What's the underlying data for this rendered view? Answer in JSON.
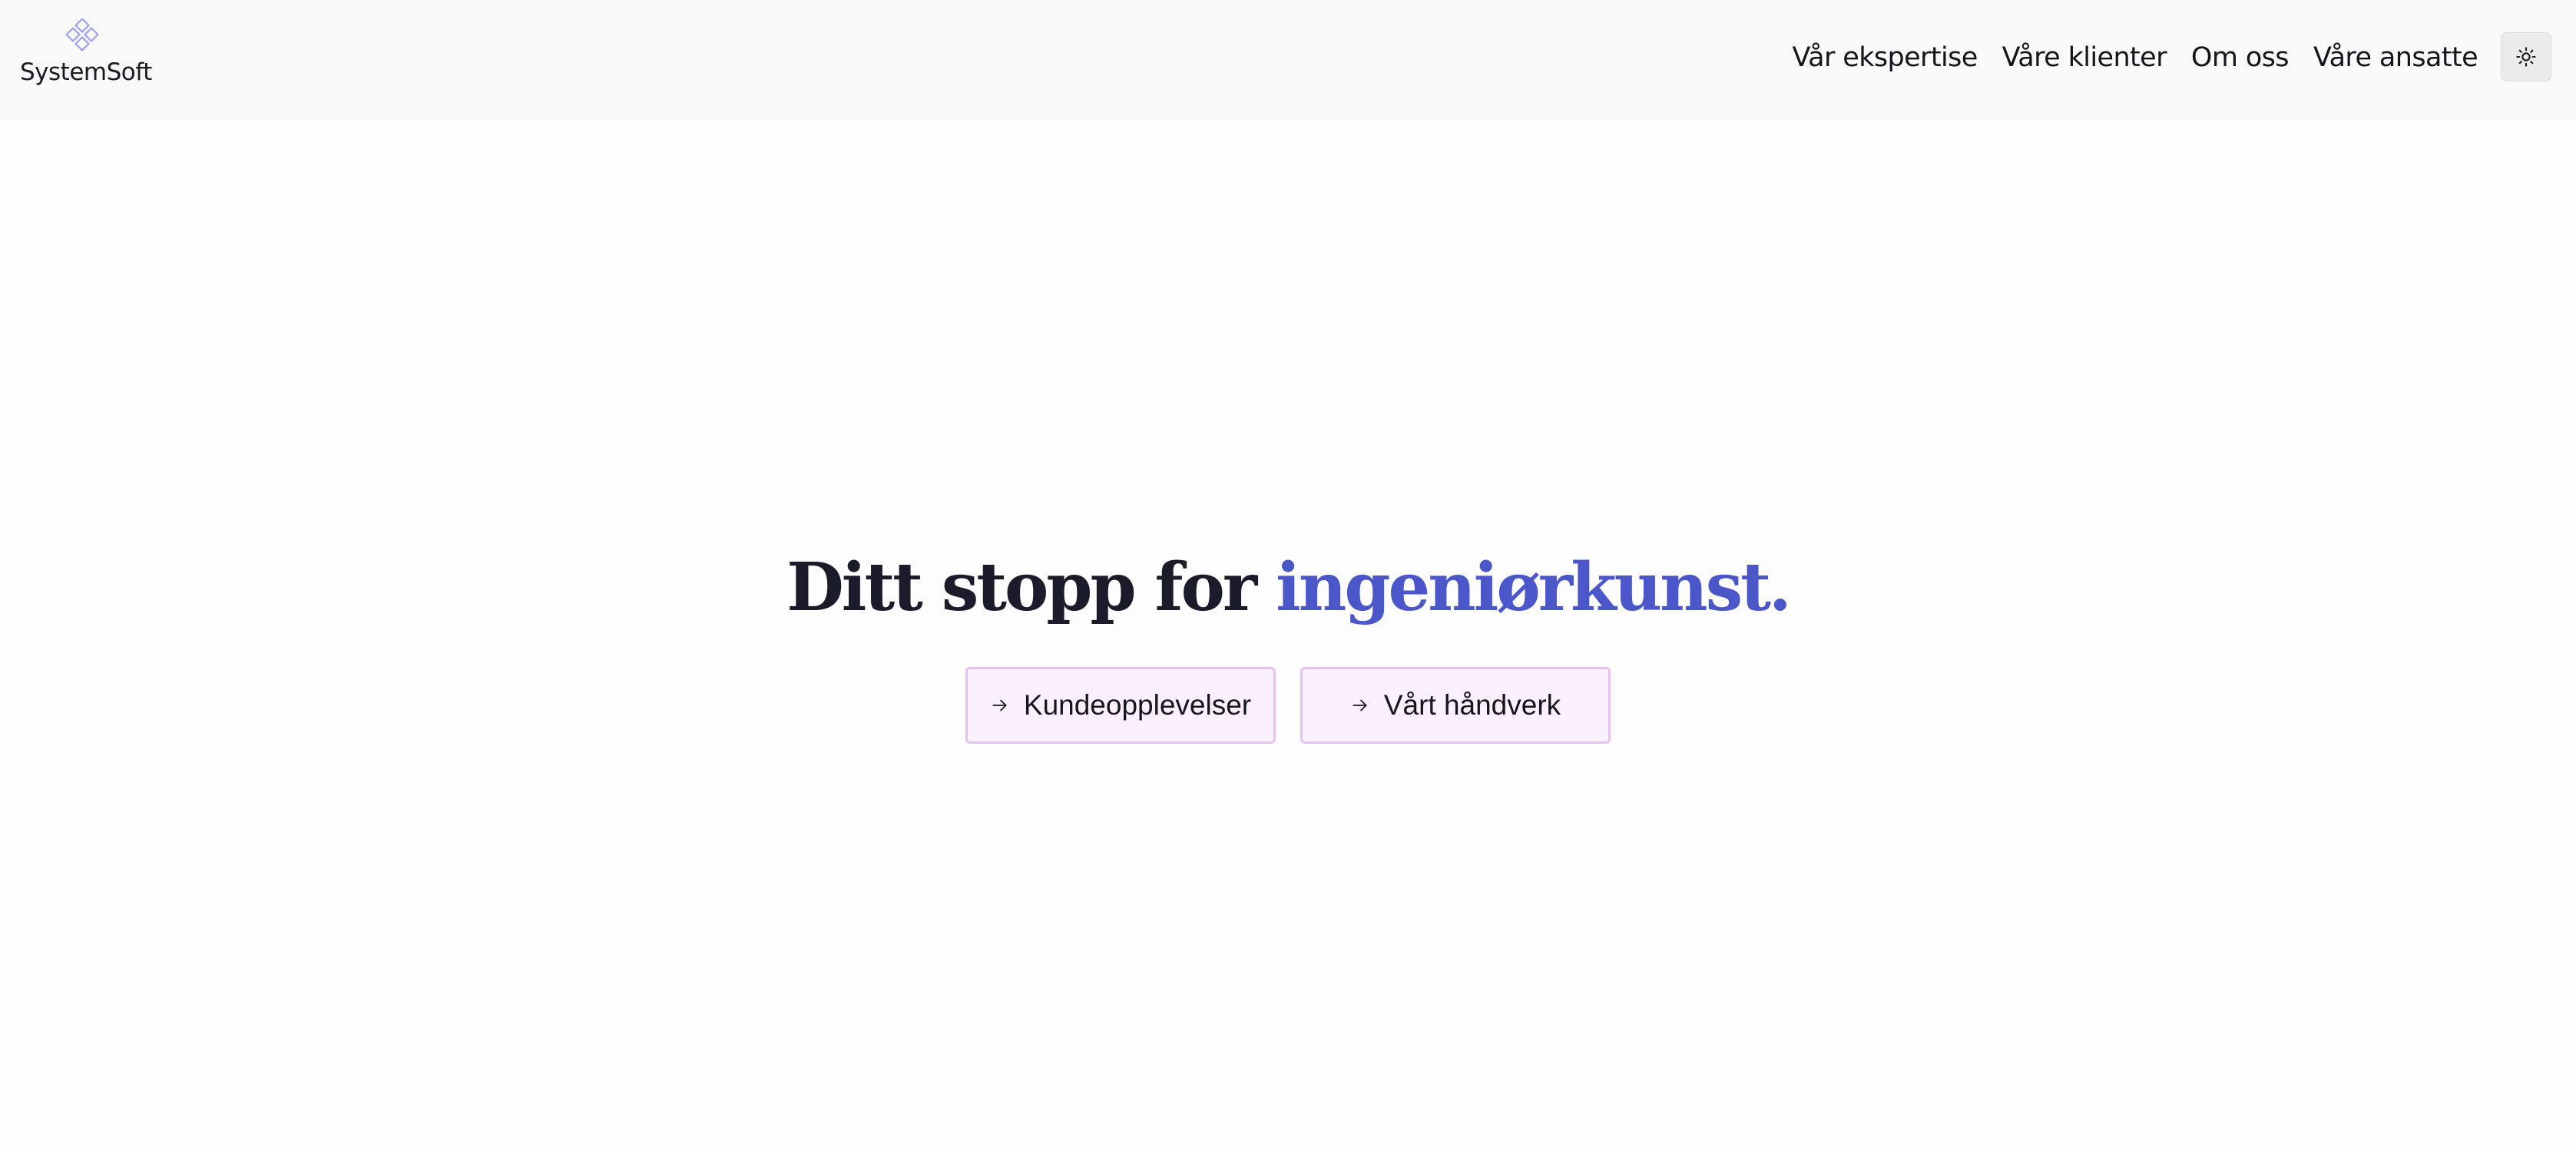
{
  "brand": {
    "name": "SystemSoft",
    "logo_icon": "diamond-cluster-icon",
    "logo_color": "#9ea4e6"
  },
  "nav": {
    "items": [
      {
        "label": "Vår ekspertise"
      },
      {
        "label": "Våre klienter"
      },
      {
        "label": "Om oss"
      },
      {
        "label": "Våre ansatte"
      }
    ],
    "theme_toggle_icon": "sun-icon"
  },
  "hero": {
    "title_prefix": "Ditt stopp for ",
    "title_accent": "ingeniørkunst.",
    "accent_color": "#4b57c8",
    "accent_color_end": "#6a4fc7",
    "buttons": [
      {
        "label": "Kundeopplevelser",
        "icon": "arrow-right-icon"
      },
      {
        "label": "Vårt håndverk",
        "icon": "arrow-right-icon"
      }
    ],
    "button_background": "#fbf0fe",
    "button_border": "#e6c2f3"
  }
}
